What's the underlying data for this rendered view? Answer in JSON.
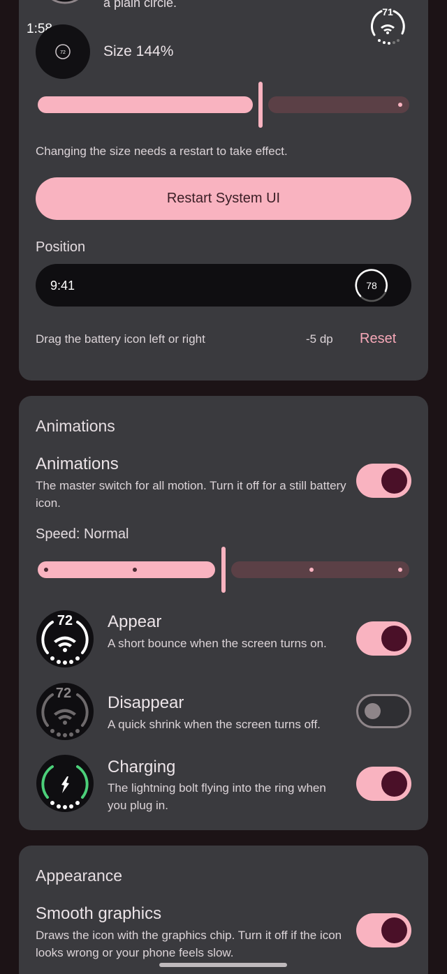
{
  "status_bar": {
    "time": "1:58",
    "battery_level": "71",
    "wifi_icon": "wifi-icon"
  },
  "size_section": {
    "previous_item_text": "a plain circle.",
    "preview_level": "72",
    "size_label": "Size 144%",
    "size_slider": {
      "value_fraction": 0.6
    },
    "restart_note": "Changing the size needs a restart to take effect.",
    "restart_button": "Restart System UI"
  },
  "position_section": {
    "title": "Position",
    "preview_time": "9:41",
    "preview_level": "78",
    "hint": "Drag the battery icon left or right",
    "offset_value": "-5 dp",
    "reset_button": "Reset"
  },
  "animations_section": {
    "header": "Animations",
    "master": {
      "title": "Animations",
      "description": "The master switch for all motion. Turn it off for a still battery icon.",
      "enabled": true
    },
    "speed_label": "Speed: Normal",
    "speed_slider": {
      "steps": 5,
      "selected_step": 2
    },
    "items": [
      {
        "title": "Appear",
        "description": "A short bounce when the screen turns on.",
        "enabled": true,
        "icon_level": "72"
      },
      {
        "title": "Disappear",
        "description": "A quick shrink when the screen turns off.",
        "enabled": false,
        "icon_level": "72"
      },
      {
        "title": "Charging",
        "description": "The lightning bolt flying into the ring when you plug in.",
        "enabled": true,
        "icon_level": ""
      }
    ]
  },
  "appearance_section": {
    "header": "Appearance",
    "smooth_graphics": {
      "title": "Smooth graphics",
      "description": "Draws the icon with the graphics chip. Turn it off if the icon looks wrong or your phone feels slow.",
      "enabled": true
    }
  },
  "colors": {
    "accent": "#f9b3c0",
    "toggle_knob_on": "#4a1028",
    "card_bg": "#3a3a3e",
    "page_bg": "#1c1316",
    "charging_green": "#4cd07a"
  }
}
